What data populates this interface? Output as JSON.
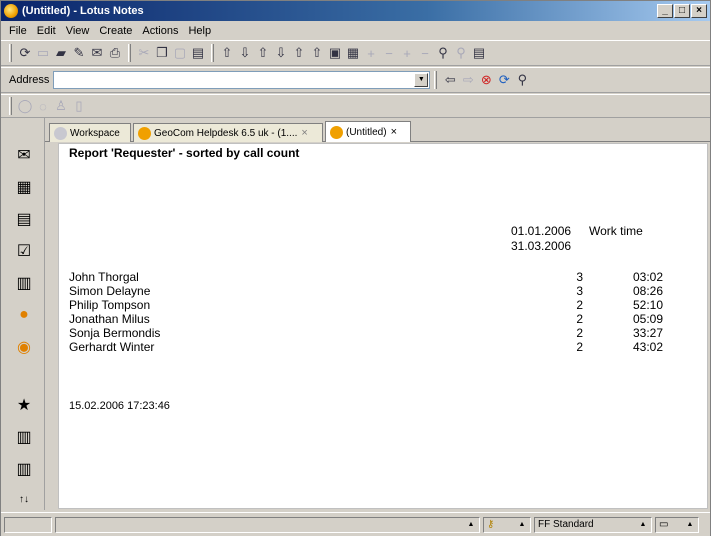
{
  "window": {
    "title": "(Untitled) - Lotus Notes"
  },
  "menu": [
    "File",
    "Edit",
    "View",
    "Create",
    "Actions",
    "Help"
  ],
  "address": {
    "label": "Address",
    "value": ""
  },
  "tabs": [
    {
      "label": "Workspace"
    },
    {
      "label": "GeoCom Helpdesk 6.5 uk - (1...."
    },
    {
      "label": "(Untitled)"
    }
  ],
  "report": {
    "title": "Report 'Requester' - sorted by call count",
    "date_from": "01.01.2006",
    "date_to": "31.03.2006",
    "worktime_header": "Work time",
    "rows": [
      {
        "name": "John Thorgal",
        "count": "3",
        "time": "03:02"
      },
      {
        "name": "Simon Delayne",
        "count": "3",
        "time": "08:26"
      },
      {
        "name": "Philip Tompson",
        "count": "2",
        "time": "52:10"
      },
      {
        "name": "Jonathan Milus",
        "count": "2",
        "time": "05:09"
      },
      {
        "name": "Sonja Bermondis",
        "count": "2",
        "time": "33:27"
      },
      {
        "name": "Gerhardt Winter",
        "count": "2",
        "time": "43:02"
      }
    ],
    "timestamp": "15.02.2006 17:23:46"
  },
  "statusbar": {
    "style": "FF Standard"
  },
  "colors": {
    "titlebar": "#0a246a",
    "chrome": "#d4d0c8",
    "accent": "#f0a000"
  }
}
